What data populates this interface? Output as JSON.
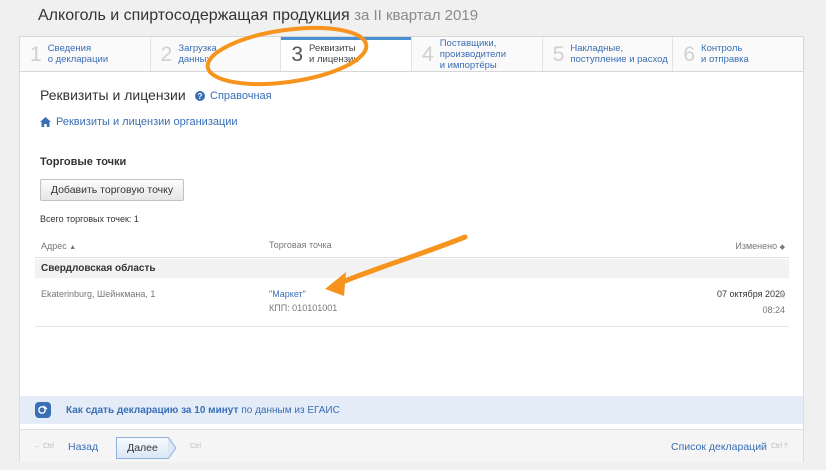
{
  "header": {
    "title": "Алкоголь и спиртосодержащая продукция",
    "period": "за II квартал 2019"
  },
  "steps": [
    {
      "num": "1",
      "label": "Сведения\nо декларации"
    },
    {
      "num": "2",
      "label": "Загрузка\nданных"
    },
    {
      "num": "3",
      "label": "Реквизиты\nи лицензии"
    },
    {
      "num": "4",
      "label": "Поставщики, производители\nи импортёры"
    },
    {
      "num": "5",
      "label": "Накладные,\nпоступление и расход"
    },
    {
      "num": "6",
      "label": "Контроль\nи отправка"
    }
  ],
  "section": {
    "title": "Реквизиты и лицензии",
    "help_link": "Справочная",
    "org_link": "Реквизиты и лицензии организации"
  },
  "shops": {
    "heading": "Торговые точки",
    "add_button": "Добавить торговую точку",
    "total": "Всего торговых точек: 1",
    "columns": {
      "address": "Адрес",
      "store": "Торговая точка",
      "changed": "Изменено"
    },
    "group": "Свердловская область",
    "rows": [
      {
        "address": "Ekaterinburg, Шейнкмана, 1",
        "store": "\"Маркет\"",
        "kpp": "КПП: 010101001",
        "date": "07 октября 2020",
        "time": "08:24"
      }
    ]
  },
  "info": {
    "bold": "Как сдать декларацию за 10 минут",
    "rest": "по данным из ЕГАИС"
  },
  "footer": {
    "hint_ctrl": "Ctrl",
    "back": "Назад",
    "next": "Далее",
    "list": "Список деклараций"
  },
  "colors": {
    "accent": "#3a6eb5",
    "annotation": "#f7941d"
  }
}
